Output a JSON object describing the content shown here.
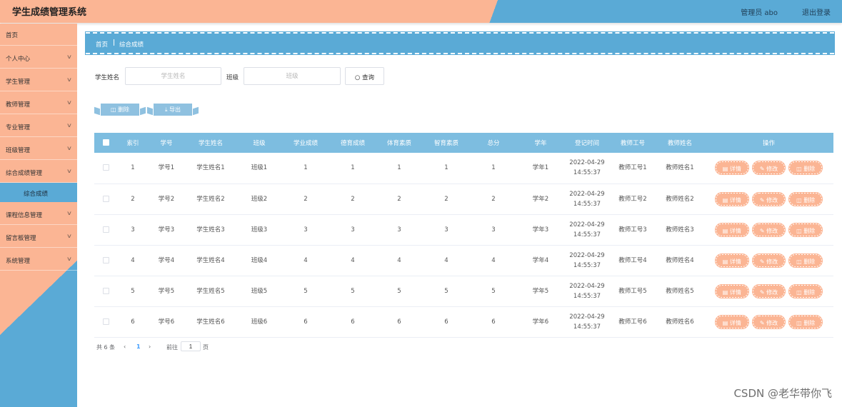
{
  "header": {
    "title": "学生成绩管理系统",
    "user": "管理员 abo",
    "logout": "退出登录"
  },
  "sidebar": {
    "items": [
      {
        "label": "首页",
        "has_chevron": false
      },
      {
        "label": "个人中心",
        "has_chevron": true
      },
      {
        "label": "学生管理",
        "has_chevron": true
      },
      {
        "label": "教师管理",
        "has_chevron": true
      },
      {
        "label": "专业管理",
        "has_chevron": true
      },
      {
        "label": "班级管理",
        "has_chevron": true
      },
      {
        "label": "综合成绩管理",
        "has_chevron": true
      },
      {
        "label": "课程信息管理",
        "has_chevron": true
      },
      {
        "label": "留言板管理",
        "has_chevron": true
      },
      {
        "label": "系统管理",
        "has_chevron": true
      }
    ],
    "active_sub": "综合成绩"
  },
  "breadcrumb": {
    "home": "首页",
    "current": "综合成绩"
  },
  "search": {
    "name_label": "学生姓名",
    "name_placeholder": "学生姓名",
    "class_label": "班级",
    "class_placeholder": "班级",
    "button": "查询"
  },
  "actions": {
    "delete": "删除",
    "export": "导出"
  },
  "table": {
    "headers": [
      "索引",
      "学号",
      "学生姓名",
      "班级",
      "学业成绩",
      "德育成绩",
      "体育素质",
      "智育素质",
      "总分",
      "学年",
      "登记时间",
      "教师工号",
      "教师姓名",
      "操作"
    ],
    "rows": [
      {
        "idx": "1",
        "sid": "学号1",
        "name": "学生姓名1",
        "cls": "班级1",
        "xy": "1",
        "dy": "1",
        "ty": "1",
        "zy": "1",
        "total": "1",
        "year": "学年1",
        "date": "2022-04-29",
        "time": "14:55:37",
        "tid": "教师工号1",
        "tname": "教师姓名1"
      },
      {
        "idx": "2",
        "sid": "学号2",
        "name": "学生姓名2",
        "cls": "班级2",
        "xy": "2",
        "dy": "2",
        "ty": "2",
        "zy": "2",
        "total": "2",
        "year": "学年2",
        "date": "2022-04-29",
        "time": "14:55:37",
        "tid": "教师工号2",
        "tname": "教师姓名2"
      },
      {
        "idx": "3",
        "sid": "学号3",
        "name": "学生姓名3",
        "cls": "班级3",
        "xy": "3",
        "dy": "3",
        "ty": "3",
        "zy": "3",
        "total": "3",
        "year": "学年3",
        "date": "2022-04-29",
        "time": "14:55:37",
        "tid": "教师工号3",
        "tname": "教师姓名3"
      },
      {
        "idx": "4",
        "sid": "学号4",
        "name": "学生姓名4",
        "cls": "班级4",
        "xy": "4",
        "dy": "4",
        "ty": "4",
        "zy": "4",
        "total": "4",
        "year": "学年4",
        "date": "2022-04-29",
        "time": "14:55:37",
        "tid": "教师工号4",
        "tname": "教师姓名4"
      },
      {
        "idx": "5",
        "sid": "学号5",
        "name": "学生姓名5",
        "cls": "班级5",
        "xy": "5",
        "dy": "5",
        "ty": "5",
        "zy": "5",
        "total": "5",
        "year": "学年5",
        "date": "2022-04-29",
        "time": "14:55:37",
        "tid": "教师工号5",
        "tname": "教师姓名5"
      },
      {
        "idx": "6",
        "sid": "学号6",
        "name": "学生姓名6",
        "cls": "班级6",
        "xy": "6",
        "dy": "6",
        "ty": "6",
        "zy": "6",
        "total": "6",
        "year": "学年6",
        "date": "2022-04-29",
        "time": "14:55:37",
        "tid": "教师工号6",
        "tname": "教师姓名6"
      }
    ],
    "row_ops": {
      "detail": "详情",
      "edit": "修改",
      "delete": "删除"
    }
  },
  "pagination": {
    "total": "共 6 条",
    "prev": "‹",
    "current_page": "1",
    "next": "›",
    "goto": "前往",
    "goto_value": "1",
    "page_unit": "页"
  },
  "watermark": "CSDN @老华带你飞",
  "colors": {
    "peach": "#fbb594",
    "blue": "#5aaad6",
    "table_header": "#7dbde0"
  }
}
